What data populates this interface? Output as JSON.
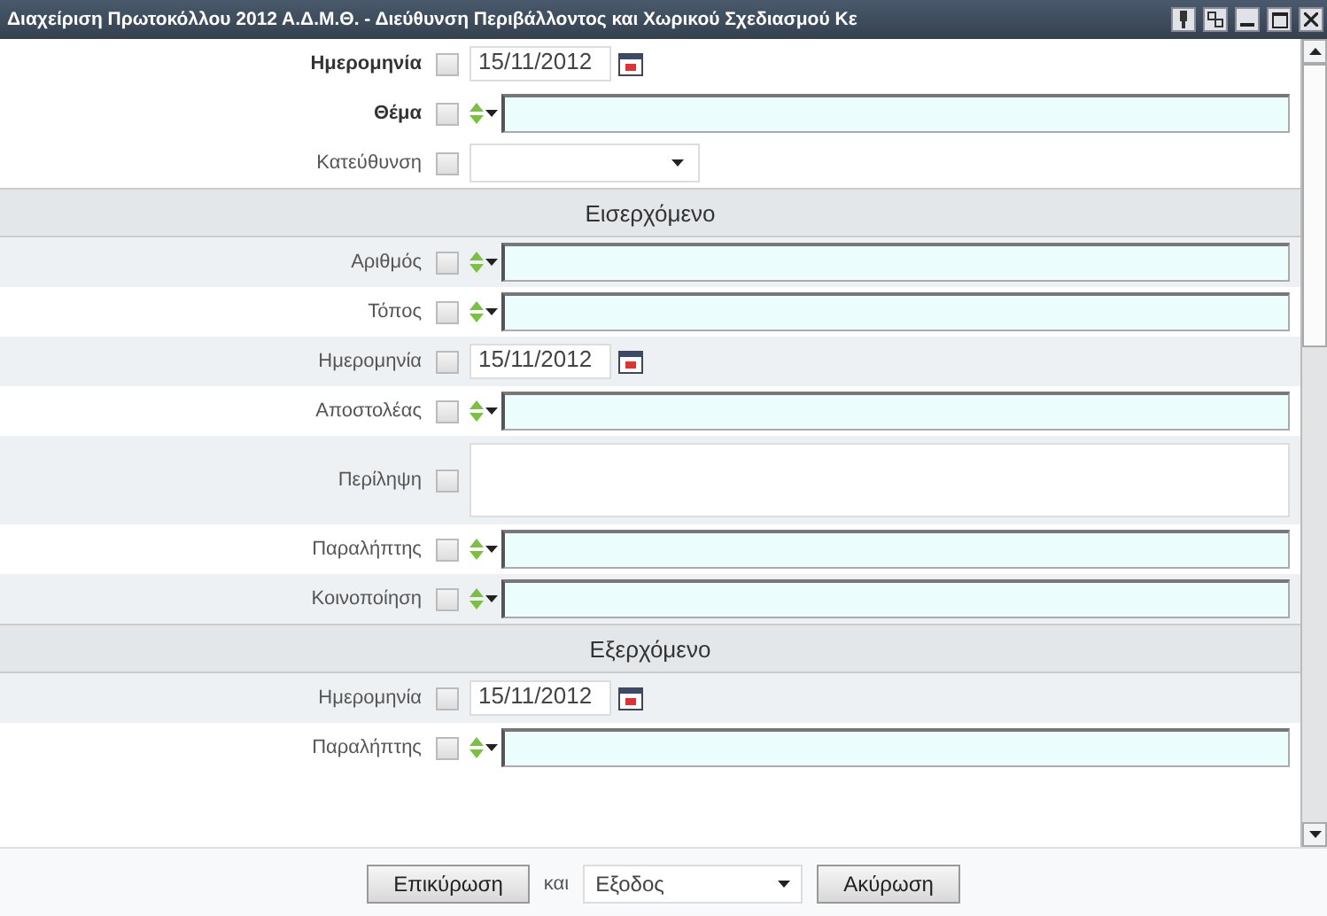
{
  "window": {
    "title": "Διαχείριση Πρωτοκόλλου 2012 Α.Δ.Μ.Θ. - Διεύθυνση Περιβάλλοντος και Χωρικού Σχεδιασμού Κε"
  },
  "fields": [
    {
      "label": "Ημερομηνία",
      "kind": "date",
      "required": true,
      "checked": false,
      "value": "15/11/2012"
    },
    {
      "label": "Θέμα",
      "kind": "combo",
      "required": true,
      "checked": false
    },
    {
      "label": "Κατεύθυνση",
      "kind": "select",
      "required": false,
      "checked": false
    }
  ],
  "sections": [
    {
      "title": "Εισερχόμενο",
      "fields": [
        {
          "label": "Αριθμός",
          "kind": "combo",
          "required": false,
          "checked": false
        },
        {
          "label": "Τόπος",
          "kind": "combo",
          "required": false,
          "checked": false
        },
        {
          "label": "Ημερομηνία",
          "kind": "date",
          "required": false,
          "checked": false,
          "value": "15/11/2012"
        },
        {
          "label": "Αποστολέας",
          "kind": "combo",
          "required": false,
          "checked": false
        },
        {
          "label": "Περίληψη",
          "kind": "textarea",
          "required": false,
          "checked": false
        },
        {
          "label": "Παραλήπτης",
          "kind": "combo",
          "required": false,
          "checked": false
        },
        {
          "label": "Κοινοποίηση",
          "kind": "combo",
          "required": false,
          "checked": false
        }
      ]
    },
    {
      "title": "Εξερχόμενο",
      "fields": [
        {
          "label": "Ημερομηνία",
          "kind": "date",
          "required": false,
          "checked": false,
          "value": "15/11/2012"
        },
        {
          "label": "Παραλήπτης",
          "kind": "combo",
          "required": false,
          "checked": false
        }
      ]
    }
  ],
  "footer": {
    "confirm": "Επικύρωση",
    "joiner": "και",
    "after_action": "Εξοδος",
    "cancel": "Ακύρωση"
  }
}
